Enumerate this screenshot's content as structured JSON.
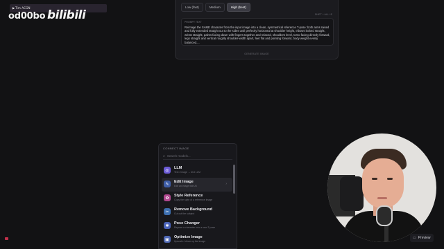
{
  "watermark": {
    "live_label": "Tim ACGN",
    "channel": "od00bo",
    "logo": "bilibili"
  },
  "upper_panel": {
    "quality_options": [
      "Low (fast)",
      "Medium",
      "High (best)"
    ],
    "selected_quality": "High (best)",
    "shortcut_hint": "SHIFT + ALL +E",
    "prompt_label": "PROMPT TEXT",
    "prompt_text": "Reimage the SAME character from the input image into a clean, symmetrical reference T-pose: both arms raised and fully extended straight out to the sides until perfectly horizontal at shoulder height, elbows locked straight, wrists straight, palms facing down with fingers together and relaxed, shoulders level, torso facing directly forward, legs straight and vertical roughly shoulder-width apart, feet flat and pointing forward, body weight evenly balanced....",
    "generate_label": "GENERATE IMAGE"
  },
  "menu": {
    "header": "CONNECT IMAGE",
    "search_placeholder": "Search models...",
    "items": [
      {
        "title": "LLM",
        "desc": "Text / image → text LLM",
        "icon": "llm-icon",
        "color": "#6b5bd6"
      },
      {
        "title": "Edit Image",
        "desc": "Edit an image with AI",
        "icon": "edit-image-icon",
        "color": "#3f5ea8"
      },
      {
        "title": "Style Reference",
        "desc": "Copy the style of a reference image",
        "icon": "style-reference-icon",
        "color": "#b0478f"
      },
      {
        "title": "Remove Background",
        "desc": "Cut out the subject",
        "icon": "remove-background-icon",
        "color": "#3d6fb0"
      },
      {
        "title": "Pose Changer",
        "desc": "Repose a character into a new T-pose",
        "icon": "pose-changer-icon",
        "color": "#4a63b8"
      },
      {
        "title": "Optimize Image",
        "desc": "Upscale / clean up the image",
        "icon": "optimize-image-icon",
        "color": "#4f68b5"
      }
    ],
    "highlighted_index": 1
  },
  "preview_button": {
    "label": "Preview",
    "icon": "preview-icon"
  },
  "colors": {
    "background": "#121214",
    "panel": "#1b1b1f",
    "accent": "#5b6ee0"
  }
}
